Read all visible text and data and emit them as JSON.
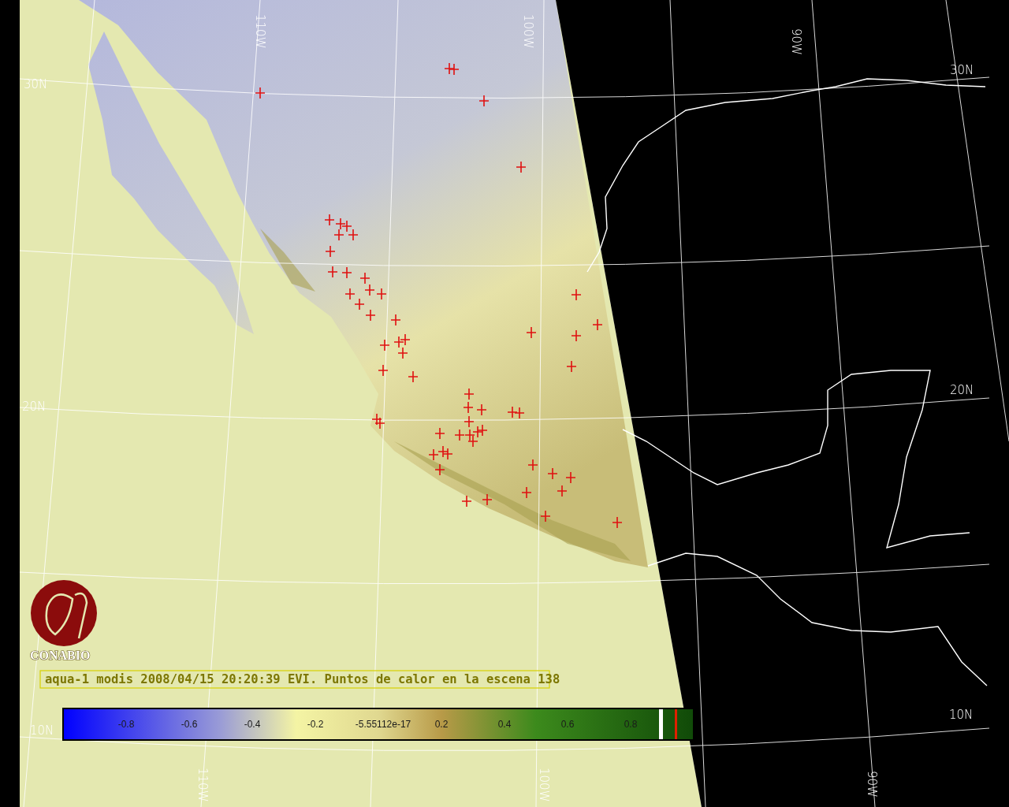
{
  "map": {
    "latitude_labels_left": [
      "30N",
      "20N",
      "10N"
    ],
    "latitude_labels_right": [
      "30N",
      "20N",
      "10N"
    ],
    "longitude_labels_top": [
      "110W",
      "100W",
      "90W"
    ],
    "longitude_labels_bottom": [
      "110W",
      "100W",
      "90W"
    ]
  },
  "logo": {
    "text": "CONABIO"
  },
  "caption": "aqua-1 modis 2008/04/15 20:20:39 EVI. Puntos de calor en la escena 138",
  "colorbar": {
    "ticks": [
      "-0.8",
      "-0.6",
      "-0.4",
      "-0.2",
      "-5.55112e-17",
      "0.2",
      "0.4",
      "0.6",
      "0.8"
    ]
  }
}
